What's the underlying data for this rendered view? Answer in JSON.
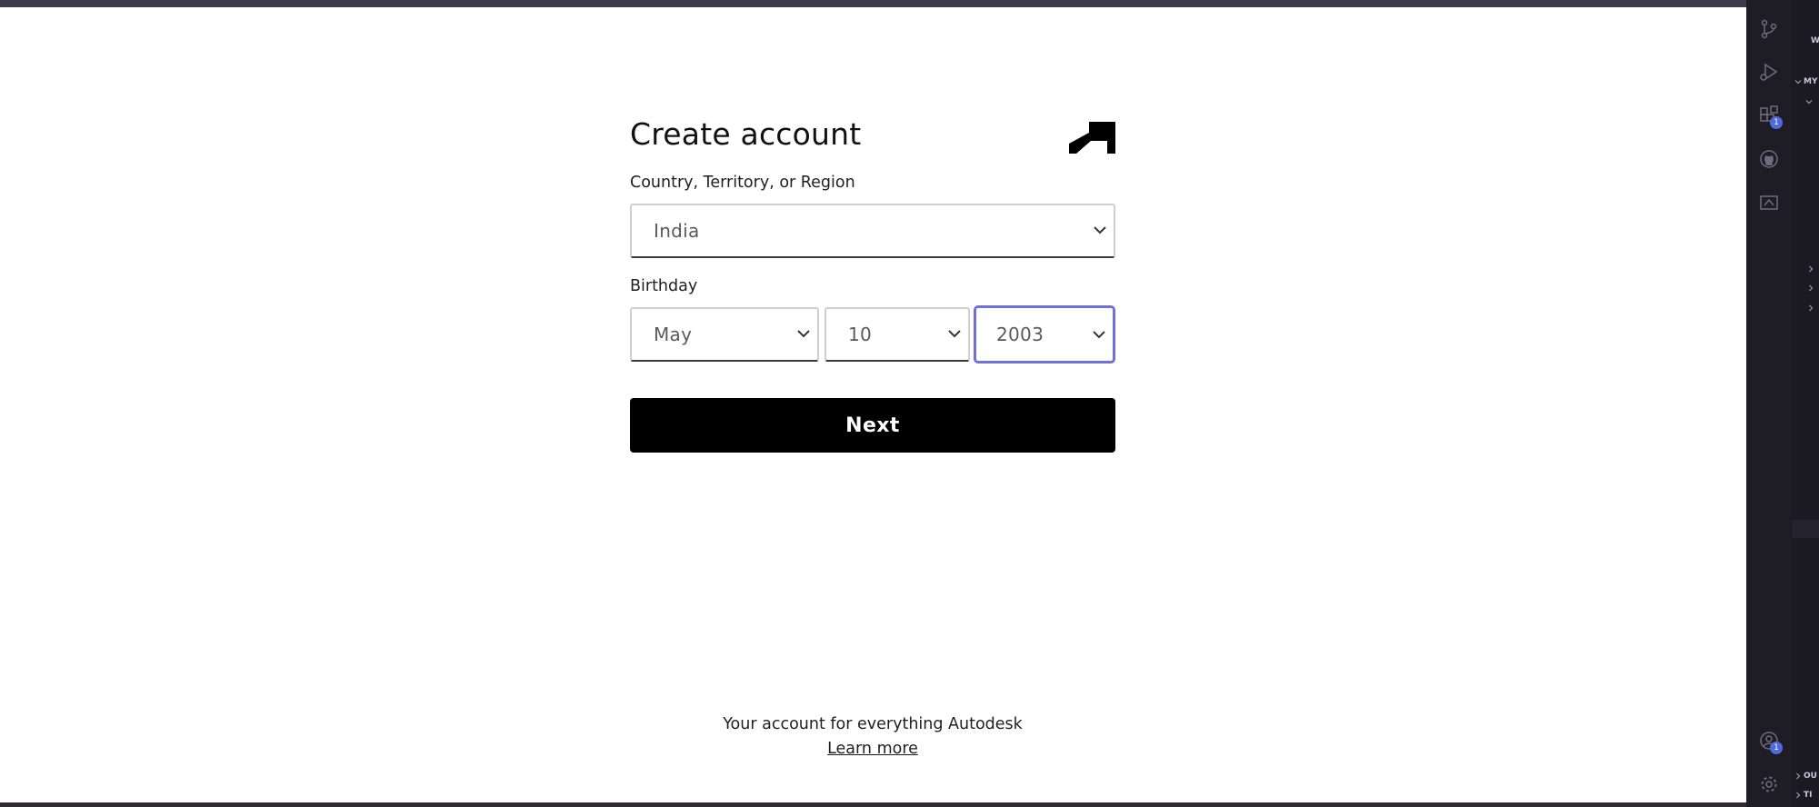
{
  "form": {
    "title": "Create account",
    "country_label": "Country, Territory, or Region",
    "country_value": "India",
    "birthday_label": "Birthday",
    "birthday_month": "May",
    "birthday_day": "10",
    "birthday_year": "2003",
    "next_label": "Next"
  },
  "footer": {
    "tagline": "Your account for everything Autodesk",
    "learn_more": "Learn more"
  },
  "ide": {
    "activity_icons": [
      "source-control-icon",
      "run-debug-icon",
      "extensions-icon",
      "github-icon",
      "remote-explorer-icon"
    ],
    "extensions_badge": "1",
    "accounts_badge": "1",
    "panel_header": "W",
    "section_header": "MY",
    "section_outline": "OU",
    "section_timeline": "TI"
  },
  "colors": {
    "focus_border": "#6f6fe0",
    "button_bg": "#000000",
    "ide_bg": "#1e1d26",
    "badge": "#4f6bd8"
  }
}
